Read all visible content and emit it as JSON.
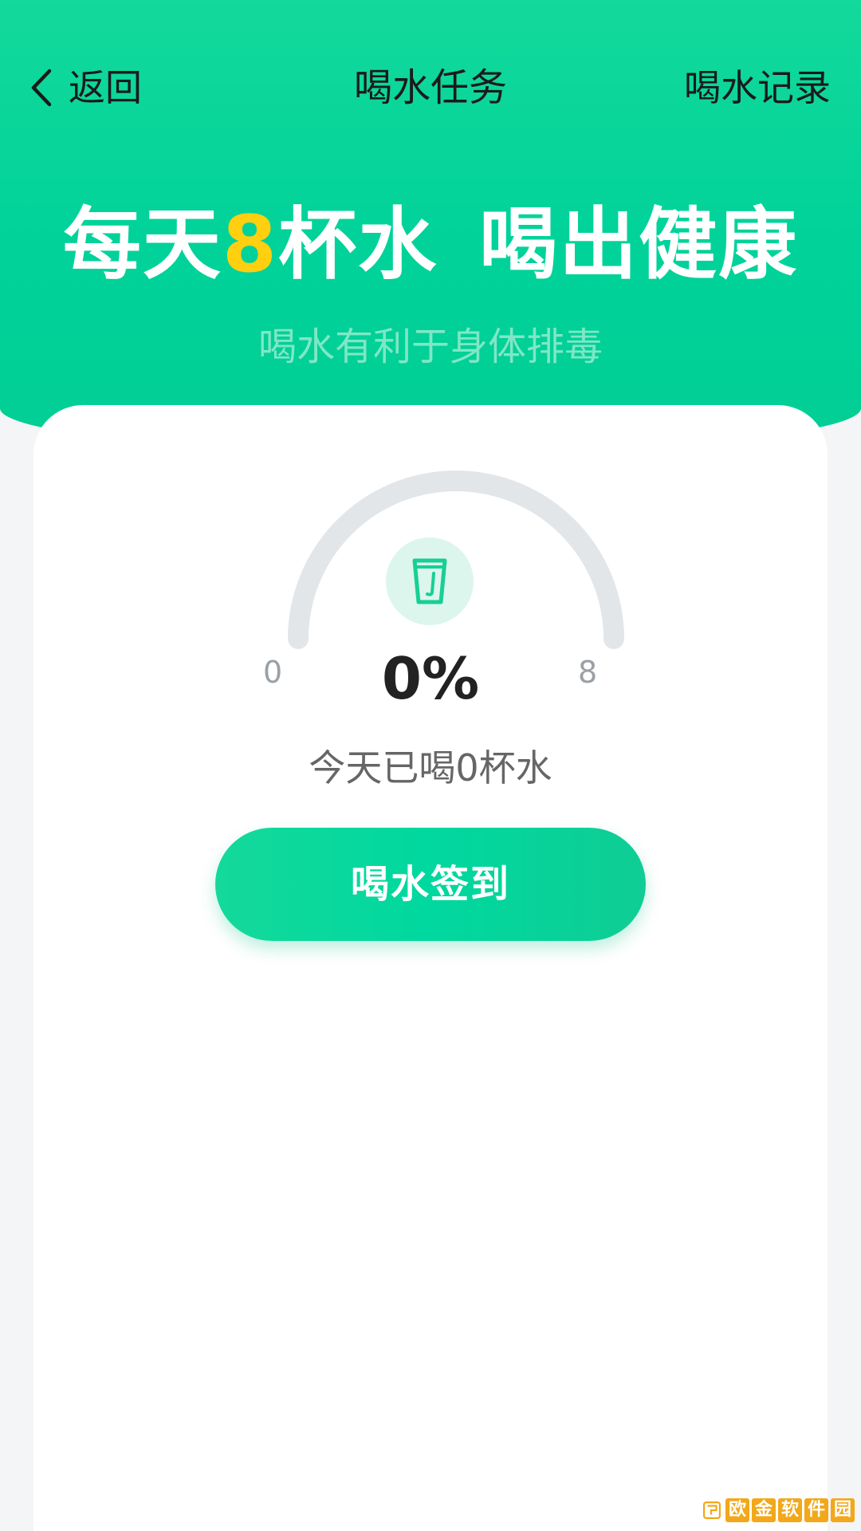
{
  "header": {
    "back_label": "返回",
    "title": "喝水任务",
    "record_label": "喝水记录"
  },
  "hero": {
    "headline_part1": "每天",
    "headline_number": "8",
    "headline_part2": "杯水",
    "headline_part3": "喝出健康",
    "subtitle": "喝水有利于身体排毒"
  },
  "progress": {
    "min_label": "0",
    "max_label": "8",
    "percent_text": "0%",
    "cups_drunk": 0,
    "cups_goal": 8,
    "today_text": "今天已喝0杯水"
  },
  "actions": {
    "checkin_label": "喝水签到"
  },
  "watermark": {
    "chars": [
      "欧",
      "金",
      "软",
      "件",
      "园"
    ]
  },
  "colors": {
    "brand_green": "#00d29a",
    "accent_yellow": "#ffcf10",
    "gauge_track": "#e3e6e9",
    "cup_icon": "#18cf95"
  },
  "icons": {
    "back": "chevron-left-icon",
    "cup": "water-cup-icon",
    "logo": "site-logo-icon"
  }
}
